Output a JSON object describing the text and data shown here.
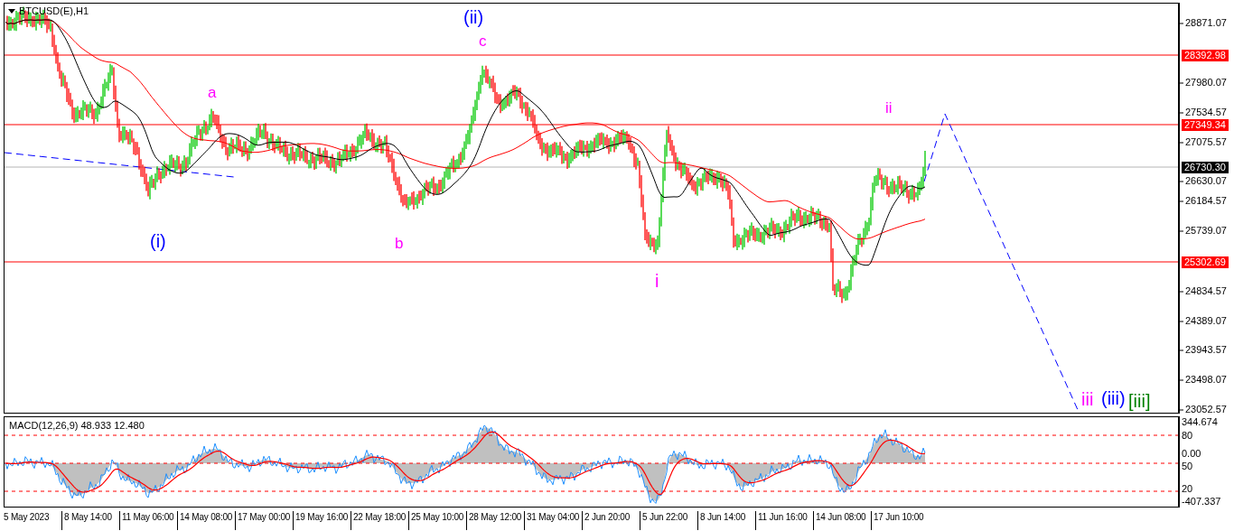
{
  "chart": {
    "title": "BTCUSD(E),H1"
  },
  "price_ticks": [
    "28871.07",
    "27980.07",
    "27534.57",
    "27075.57",
    "26630.07",
    "26184.57",
    "25739.07",
    "24834.57",
    "24389.07",
    "23943.57",
    "23498.07",
    "23052.57"
  ],
  "price_levels": [
    {
      "label": "28392.98",
      "color": "#ff0000"
    },
    {
      "label": "27349.34",
      "color": "#ff0000"
    },
    {
      "label": "26730.30",
      "color": "#000000"
    },
    {
      "label": "25302.69",
      "color": "#ff0000"
    }
  ],
  "wave_labels": [
    {
      "text": "(i)",
      "color": "#0000ff"
    },
    {
      "text": "a",
      "color": "#ff00ff"
    },
    {
      "text": "b",
      "color": "#ff00ff"
    },
    {
      "text": "(ii)",
      "color": "#0000ff"
    },
    {
      "text": "c",
      "color": "#ff00ff"
    },
    {
      "text": "i",
      "color": "#ff00ff"
    },
    {
      "text": "ii",
      "color": "#ff00ff"
    },
    {
      "text": "iii",
      "color": "#ff00ff"
    },
    {
      "text": "(iii)",
      "color": "#0000ff"
    },
    {
      "text": "[iii]",
      "color": "#008000"
    }
  ],
  "macd": {
    "title": "MACD(12,26,9) 48.933 12.480",
    "axis_labels": [
      "344.674",
      "80",
      "0.00",
      "50",
      "20",
      "-407.337"
    ]
  },
  "time_axis": [
    "5 May 2023",
    "8 May 14:00",
    "11 May 06:00",
    "14 May 08:00",
    "17 May 00:00",
    "19 May 16:00",
    "22 May 18:00",
    "25 May 10:00",
    "28 May 12:00",
    "31 May 04:00",
    "2 Jun 20:00",
    "5 Jun 22:00",
    "8 Jun 14:00",
    "11 Jun 16:00",
    "14 Jun 08:00",
    "17 Jun 10:00"
  ]
}
